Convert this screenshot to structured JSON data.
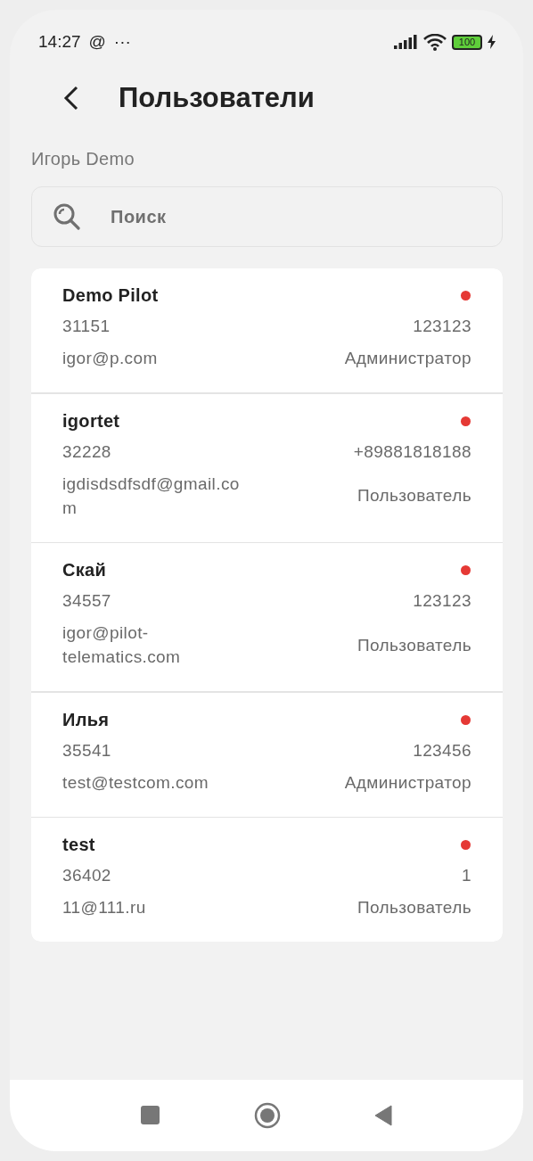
{
  "status_bar": {
    "time": "14:27",
    "at_sign": "@",
    "more": "···",
    "battery": "100"
  },
  "header": {
    "title": "Пользователи"
  },
  "account": {
    "name": "Игорь Demo"
  },
  "search": {
    "placeholder": "Поиск"
  },
  "users": [
    {
      "name": "Demo Pilot",
      "id": "31151",
      "phone": "123123",
      "email": "igor@p.com",
      "role": "Администратор",
      "color": "#e53935"
    },
    {
      "name": "igortet",
      "id": "32228",
      "phone": "+89881818188",
      "email": "igdisdsdfsdf@gmail.com",
      "role": "Пользователь",
      "color": "#e53935"
    },
    {
      "name": "Скай",
      "id": "34557",
      "phone": "123123",
      "email": "igor@pilot-telematics.com",
      "role": "Пользователь",
      "color": "#e53935"
    },
    {
      "name": "Илья",
      "id": "35541",
      "phone": "123456",
      "email": "test@testcom.com",
      "role": "Администратор",
      "color": "#e53935"
    },
    {
      "name": "test",
      "id": "36402",
      "phone": "1",
      "email": "11@111.ru",
      "role": "Пользователь",
      "color": "#e53935"
    }
  ]
}
